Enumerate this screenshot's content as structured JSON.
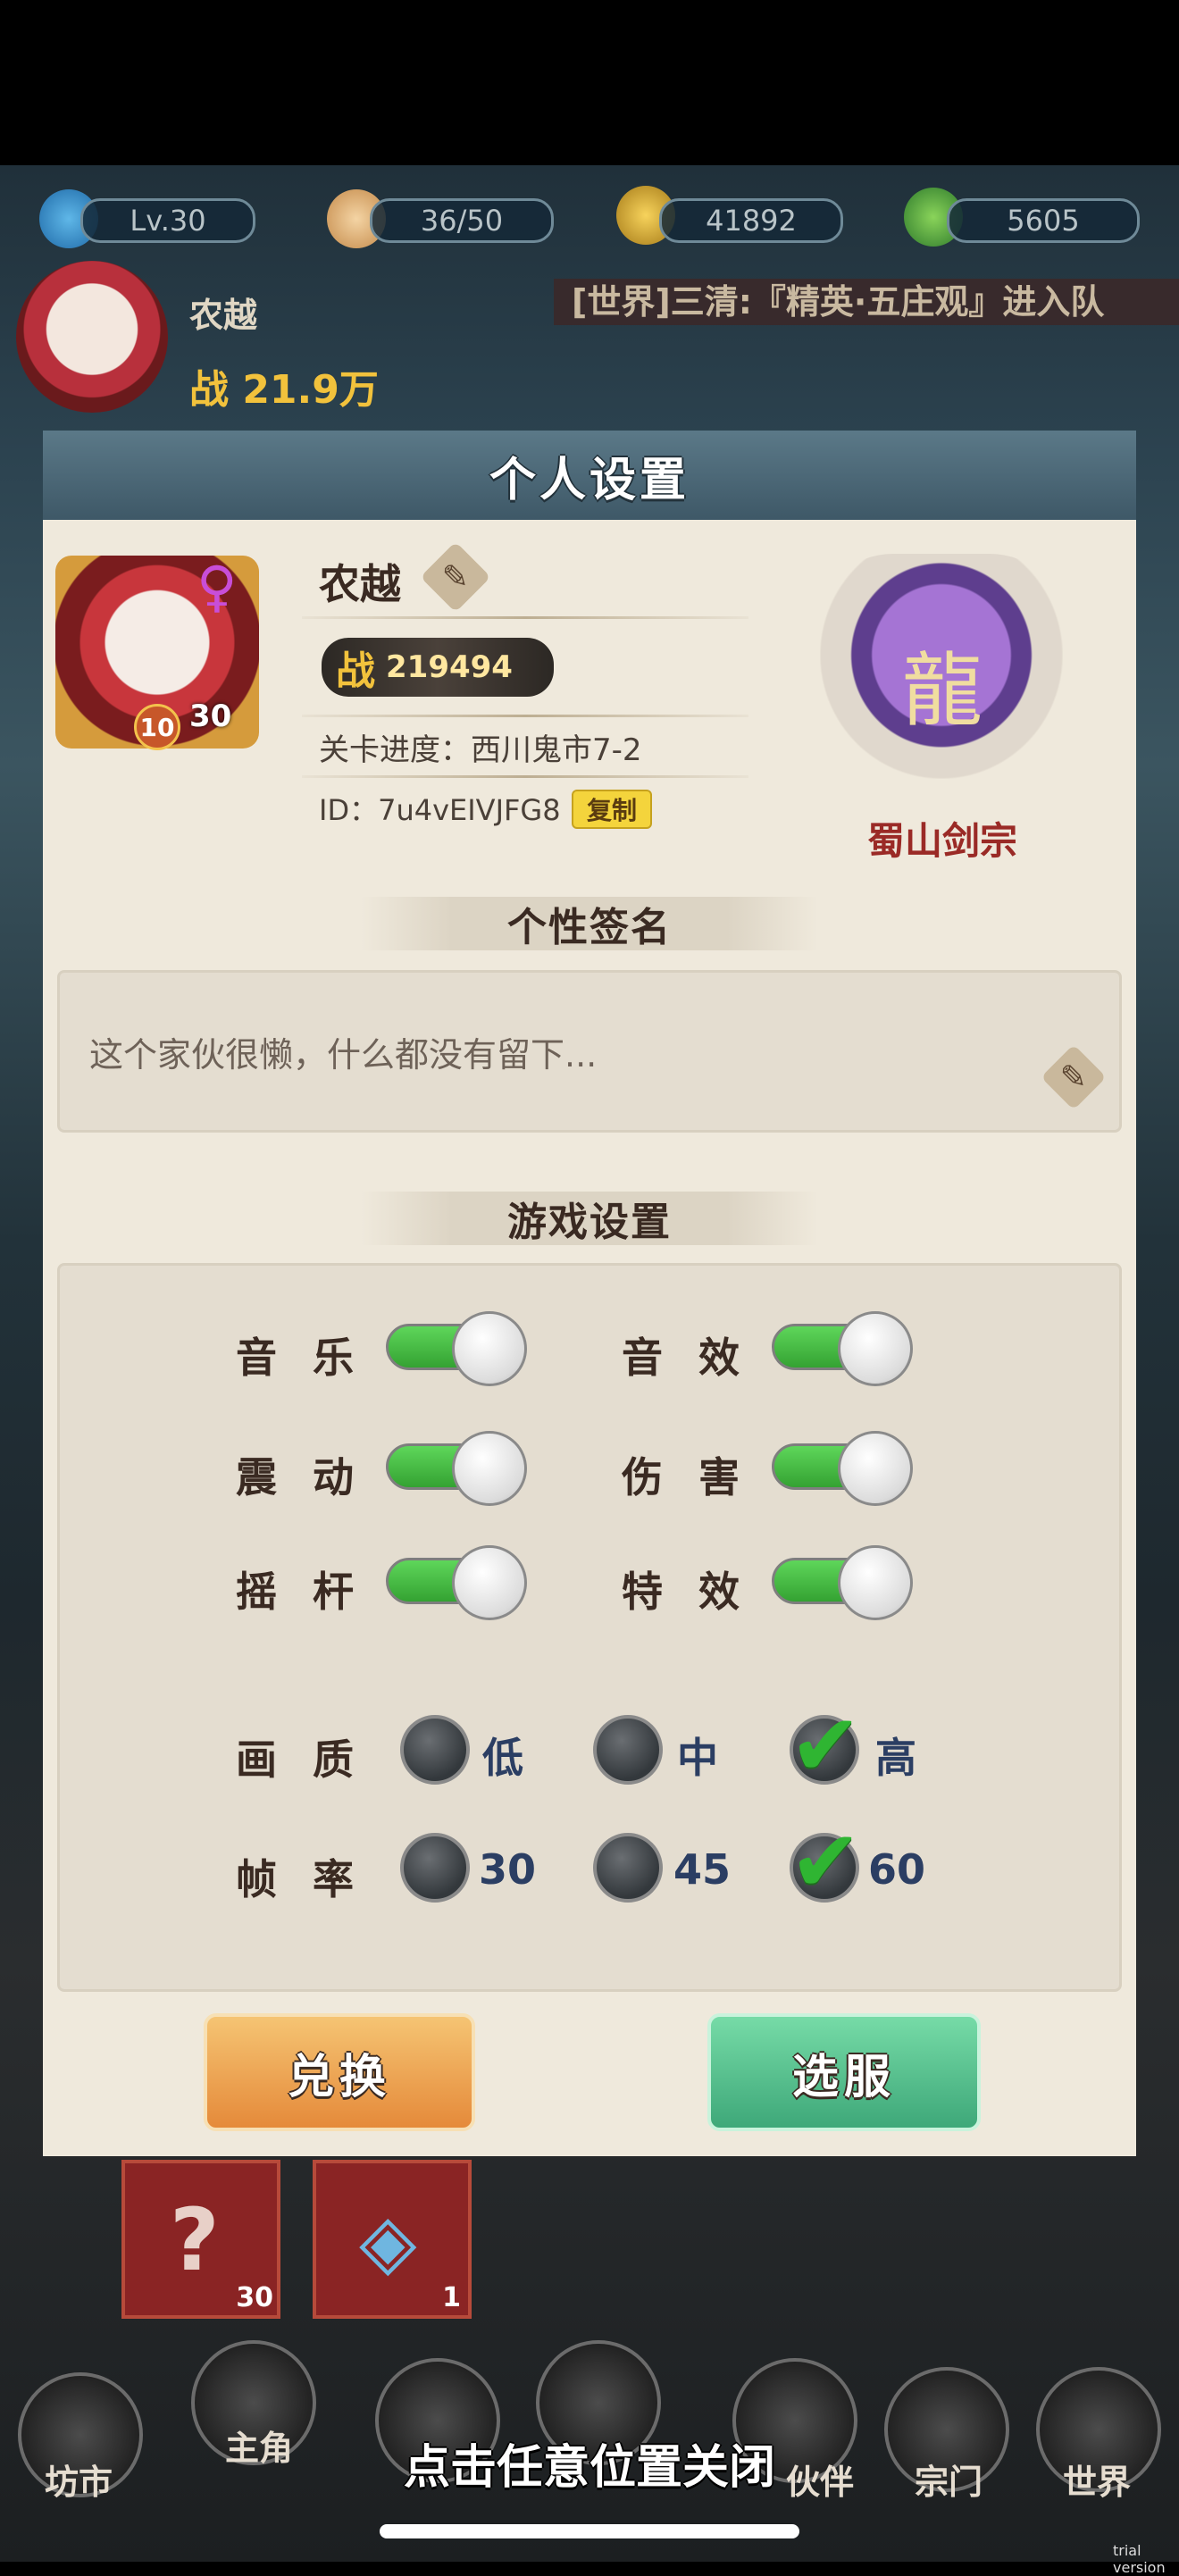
{
  "topbar": {
    "level": "Lv.30",
    "stamina": "36/50",
    "coins": "41892",
    "jade": "5605"
  },
  "player_bar": {
    "name": "农越",
    "power": "战 21.9万"
  },
  "ticker": "[世界]三清:『精英·五庄观』进入队",
  "modal": {
    "title": "个人设置",
    "profile": {
      "name": "农越",
      "gender_symbol": "♀",
      "power_glyph": "战",
      "power_value": "219494",
      "stage": "关卡进度：西川鬼市7-2",
      "id": "ID：7u4vEIVJFG8",
      "copy_label": "复制",
      "badge_level": "10",
      "level": "30",
      "sect_name": "蜀山剑宗"
    },
    "signature": {
      "header": "个性签名",
      "text": "这个家伙很懒，什么都没有留下..."
    },
    "settings": {
      "header": "游戏设置",
      "toggles": [
        {
          "label": "音乐",
          "on": true
        },
        {
          "label": "音效",
          "on": true
        },
        {
          "label": "震动",
          "on": true
        },
        {
          "label": "伤害",
          "on": true
        },
        {
          "label": "摇杆",
          "on": true
        },
        {
          "label": "特效",
          "on": true
        }
      ],
      "quality": {
        "label": "画质",
        "options": [
          "低",
          "中",
          "高"
        ],
        "selected": "高"
      },
      "framerate": {
        "label": "帧率",
        "options": [
          "30",
          "45",
          "60"
        ],
        "selected": "60"
      }
    },
    "buttons": {
      "exchange": "兑换",
      "server": "选服"
    }
  },
  "items": [
    {
      "icon": "?",
      "count": "30"
    },
    {
      "icon": "◈",
      "count": "1"
    }
  ],
  "nav": [
    "坊市",
    "主角",
    "",
    "",
    "伙伴",
    "宗门",
    "世界"
  ],
  "close_hint": "点击任意位置关闭",
  "watermark": "trial version",
  "colors": {
    "toggle_on": "#34a232",
    "exchange_button": "#e58a3a",
    "server_button": "#3ea879",
    "sect_name": "#9a2a26"
  }
}
